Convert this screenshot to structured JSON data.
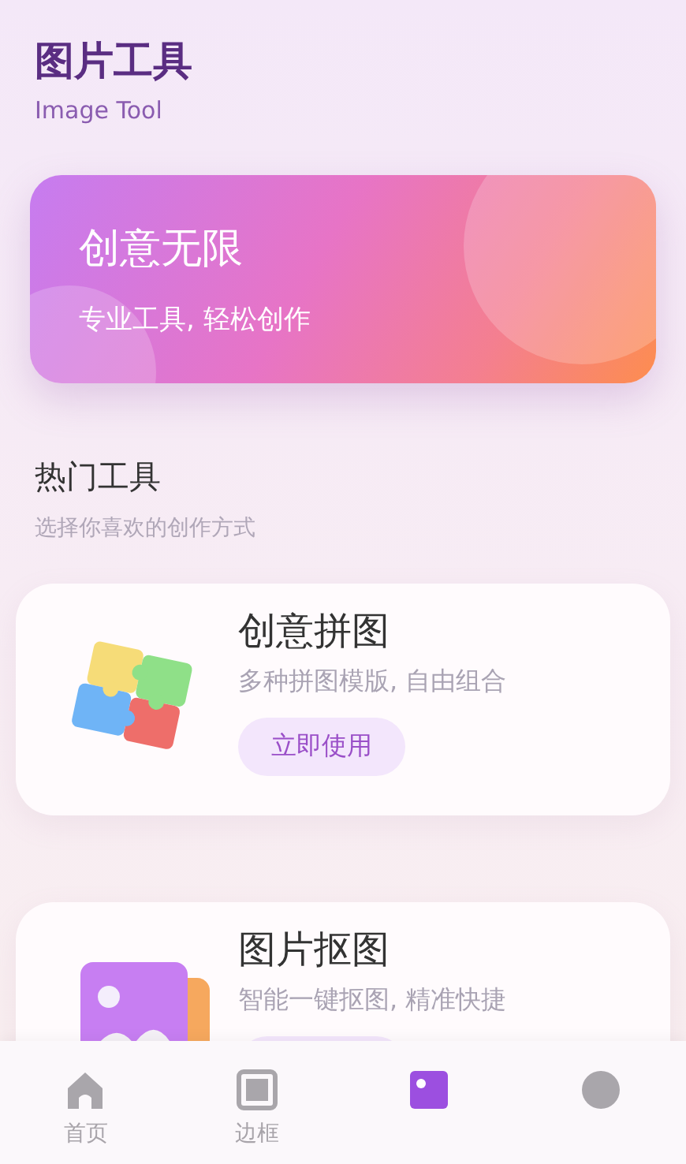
{
  "header": {
    "title": "图片工具",
    "subtitle": "Image Tool"
  },
  "banner": {
    "title": "创意无限",
    "subtitle": "专业工具, 轻松创作"
  },
  "section": {
    "title": "热门工具",
    "subtitle": "选择你喜欢的创作方式"
  },
  "tools": [
    {
      "kind": "puzzle",
      "title": "创意拼图",
      "description": "多种拼图模版, 自由组合",
      "button": "立即使用"
    },
    {
      "kind": "cutout",
      "title": "图片抠图",
      "description": "智能一键抠图, 精准快捷"
    }
  ],
  "tab_bar": [
    {
      "kind": "home",
      "label": "首页",
      "selected": false
    },
    {
      "kind": "frame",
      "label": "边框",
      "selected": false
    },
    {
      "kind": "image",
      "selected": true
    },
    {
      "kind": "profile",
      "selected": false
    }
  ]
}
